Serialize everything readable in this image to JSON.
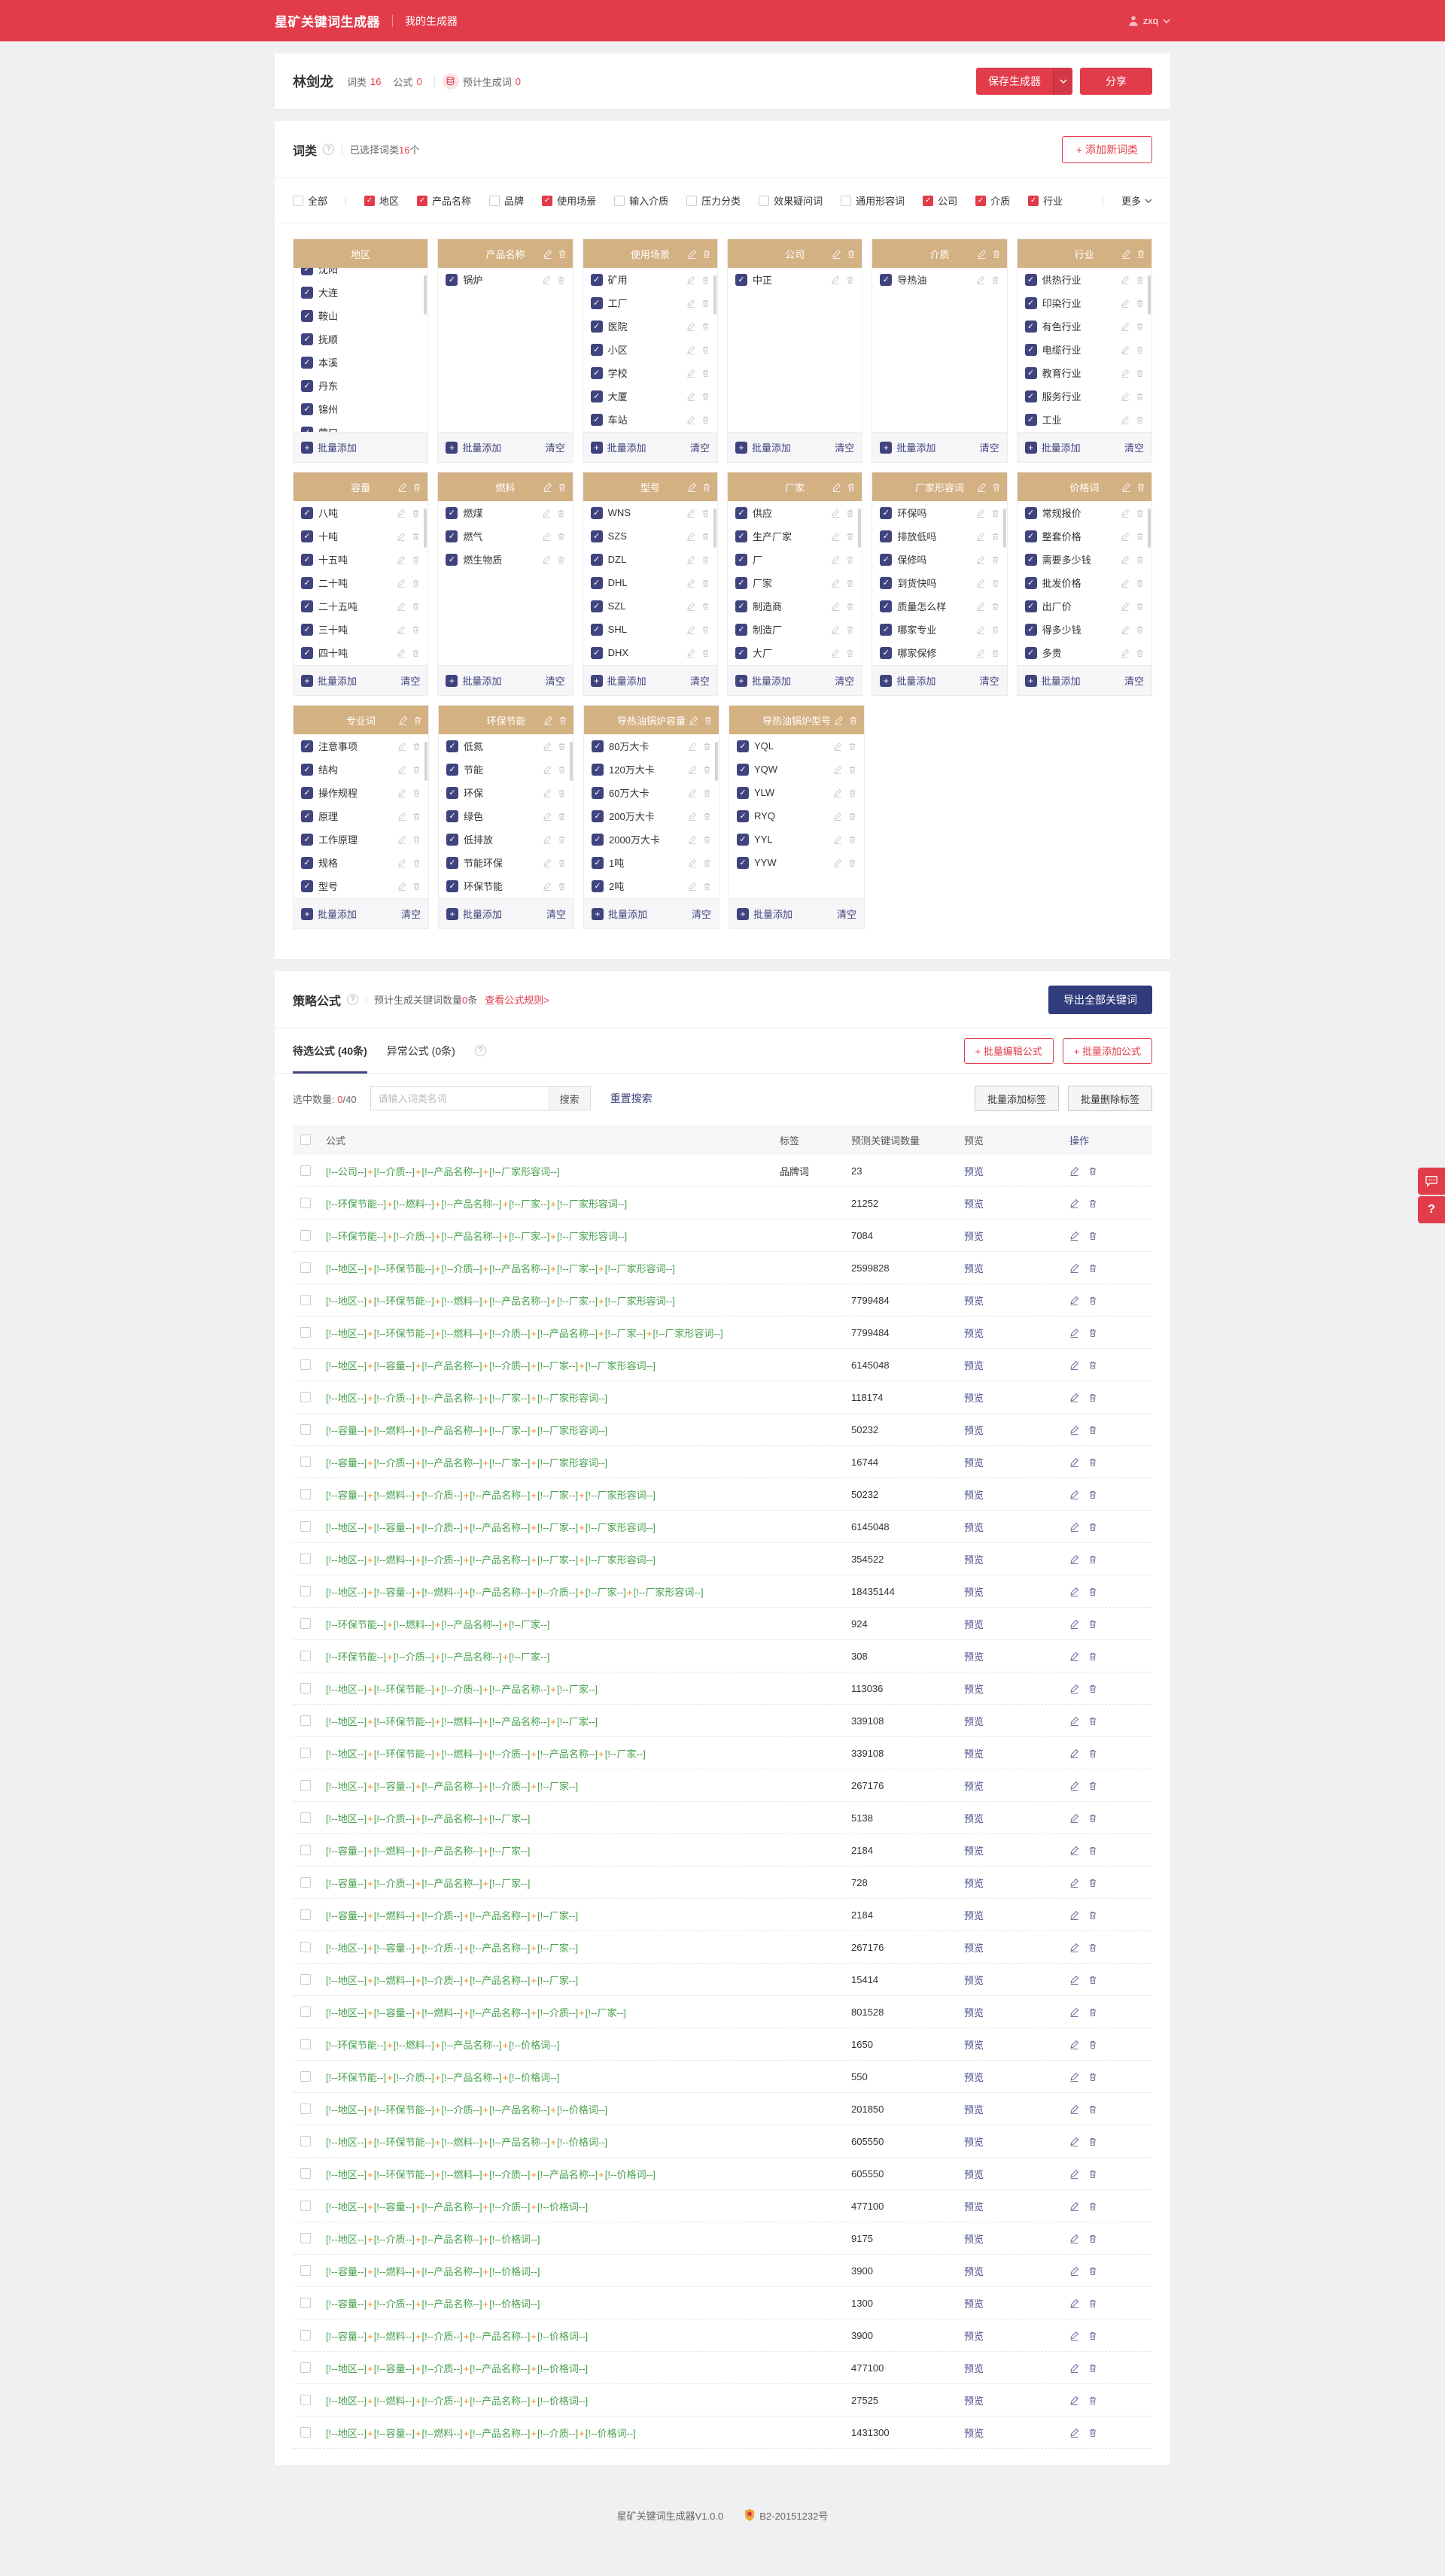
{
  "header": {
    "logo": "星矿关键词生成器",
    "nav_my_generator": "我的生成器",
    "username": "zxq"
  },
  "titlebar": {
    "name": "林剑龙",
    "wordclass_label": "词类",
    "wordclass_count": "16",
    "formula_label": "公式",
    "formula_count": "0",
    "estimate_label": "预计生成词",
    "estimate_count": "0",
    "save_button": "保存生成器",
    "share_button": "分享"
  },
  "wordclass": {
    "title": "词类",
    "selected_prefix": "已选择词类",
    "selected_count": "16",
    "selected_suffix": "个",
    "add_button_label": "+ 添加新词类",
    "more_label": "更多",
    "batch_add_label": "批量添加",
    "clear_label": "清空",
    "filters": [
      {
        "label": "全部",
        "checked": false
      },
      {
        "label": "地区",
        "checked": true
      },
      {
        "label": "产品名称",
        "checked": true
      },
      {
        "label": "品牌",
        "checked": false
      },
      {
        "label": "使用场景",
        "checked": true
      },
      {
        "label": "输入介质",
        "checked": false
      },
      {
        "label": "压力分类",
        "checked": false
      },
      {
        "label": "效果疑问词",
        "checked": false
      },
      {
        "label": "通用形容词",
        "checked": false
      },
      {
        "label": "公司",
        "checked": true
      },
      {
        "label": "介质",
        "checked": true
      },
      {
        "label": "行业",
        "checked": true
      }
    ],
    "card_rows": [
      [
        {
          "title": "地区",
          "editable": false,
          "scrollbar": true,
          "scrolled": true,
          "items": [
            "沈阳",
            "大连",
            "鞍山",
            "抚顺",
            "本溪",
            "丹东",
            "锦州",
            "营口"
          ]
        },
        {
          "title": "产品名称",
          "scrollbar": false,
          "items": [
            "锅炉"
          ]
        },
        {
          "title": "使用场景",
          "scrollbar": true,
          "items": [
            "矿用",
            "工厂",
            "医院",
            "小区",
            "学校",
            "大厦",
            "车站"
          ]
        },
        {
          "title": "公司",
          "scrollbar": false,
          "items": [
            "中正"
          ]
        },
        {
          "title": "介质",
          "scrollbar": false,
          "items": [
            "导热油"
          ]
        },
        {
          "title": "行业",
          "scrollbar": true,
          "items": [
            "供热行业",
            "印染行业",
            "有色行业",
            "电缆行业",
            "教育行业",
            "服务行业",
            "工业"
          ]
        }
      ],
      [
        {
          "title": "容量",
          "scrollbar": true,
          "items": [
            "八吨",
            "十吨",
            "十五吨",
            "二十吨",
            "二十五吨",
            "三十吨",
            "四十吨"
          ]
        },
        {
          "title": "燃料",
          "scrollbar": false,
          "items": [
            "燃煤",
            "燃气",
            "燃生物质"
          ]
        },
        {
          "title": "型号",
          "scrollbar": true,
          "items": [
            "WNS",
            "SZS",
            "DZL",
            "DHL",
            "SZL",
            "SHL",
            "DHX"
          ]
        },
        {
          "title": "厂家",
          "scrollbar": true,
          "items": [
            "供应",
            "生产厂家",
            "厂",
            "厂家",
            "制造商",
            "制造厂",
            "大厂"
          ]
        },
        {
          "title": "厂家形容词",
          "scrollbar": true,
          "items": [
            "环保吗",
            "排放低吗",
            "保修吗",
            "到货快吗",
            "质量怎么样",
            "哪家专业",
            "哪家保修"
          ]
        },
        {
          "title": "价格词",
          "scrollbar": true,
          "items": [
            "常规报价",
            "整套价格",
            "需要多少钱",
            "批发价格",
            "出厂价",
            "得多少钱",
            "多贵"
          ]
        }
      ],
      [
        {
          "title": "专业词",
          "scrollbar": true,
          "items": [
            "注意事项",
            "结构",
            "操作规程",
            "原理",
            "工作原理",
            "规格",
            "型号"
          ]
        },
        {
          "title": "环保节能",
          "scrollbar": true,
          "items": [
            "低氮",
            "节能",
            "环保",
            "绿色",
            "低排放",
            "节能环保",
            "环保节能"
          ]
        },
        {
          "title": "导热油锅炉容量",
          "scrollbar": true,
          "items": [
            "80万大卡",
            "120万大卡",
            "60万大卡",
            "200万大卡",
            "2000万大卡",
            "1吨",
            "2吨"
          ]
        },
        {
          "title": "导热油锅炉型号",
          "scrollbar": false,
          "items": [
            "YQL",
            "YQW",
            "YLW",
            "RYQ",
            "YYL",
            "YYW"
          ]
        }
      ]
    ]
  },
  "strategy": {
    "title": "策略公式",
    "estimate_prefix": "预计生成关键词数量",
    "estimate_count": "0",
    "estimate_suffix": "条",
    "rules_link": "查看公式规则>",
    "export_button": "导出全部关键词",
    "tab_pending": "待选公式 (40条)",
    "tab_abnormal": "异常公式 (0条)",
    "batch_edit_button": "+ 批量编辑公式",
    "batch_add_button": "+ 批量添加公式",
    "selected_label": "选中数量:",
    "selected_value": "0",
    "selected_total": "/40",
    "search_placeholder": "请输入词类名词",
    "search_button": "搜索",
    "reset_search": "重置搜索",
    "batch_add_tag_button": "批量添加标签",
    "batch_delete_tag_button": "批量删除标签",
    "table": {
      "headers": {
        "formula": "公式",
        "tag": "标签",
        "count": "预测关键词数量",
        "preview": "预览",
        "action": "操作"
      },
      "preview_label": "预览",
      "rows": [
        {
          "formula": "[!--公司--]+[!--介质--]+[!--产品名称--]+[!--厂家形容词--]",
          "tag": "品牌词",
          "count": "23"
        },
        {
          "formula": "[!--环保节能--]+[!--燃料--]+[!--产品名称--]+[!--厂家--]+[!--厂家形容词--]",
          "tag": "",
          "count": "21252"
        },
        {
          "formula": "[!--环保节能--]+[!--介质--]+[!--产品名称--]+[!--厂家--]+[!--厂家形容词--]",
          "tag": "",
          "count": "7084"
        },
        {
          "formula": "[!--地区--]+[!--环保节能--]+[!--介质--]+[!--产品名称--]+[!--厂家--]+[!--厂家形容词--]",
          "tag": "",
          "count": "2599828"
        },
        {
          "formula": "[!--地区--]+[!--环保节能--]+[!--燃料--]+[!--产品名称--]+[!--厂家--]+[!--厂家形容词--]",
          "tag": "",
          "count": "7799484"
        },
        {
          "formula": "[!--地区--]+[!--环保节能--]+[!--燃料--]+[!--介质--]+[!--产品名称--]+[!--厂家--]+[!--厂家形容词--]",
          "tag": "",
          "count": "7799484"
        },
        {
          "formula": "[!--地区--]+[!--容量--]+[!--产品名称--]+[!--介质--]+[!--厂家--]+[!--厂家形容词--]",
          "tag": "",
          "count": "6145048"
        },
        {
          "formula": "[!--地区--]+[!--介质--]+[!--产品名称--]+[!--厂家--]+[!--厂家形容词--]",
          "tag": "",
          "count": "118174"
        },
        {
          "formula": "[!--容量--]+[!--燃料--]+[!--产品名称--]+[!--厂家--]+[!--厂家形容词--]",
          "tag": "",
          "count": "50232"
        },
        {
          "formula": "[!--容量--]+[!--介质--]+[!--产品名称--]+[!--厂家--]+[!--厂家形容词--]",
          "tag": "",
          "count": "16744"
        },
        {
          "formula": "[!--容量--]+[!--燃料--]+[!--介质--]+[!--产品名称--]+[!--厂家--]+[!--厂家形容词--]",
          "tag": "",
          "count": "50232"
        },
        {
          "formula": "[!--地区--]+[!--容量--]+[!--介质--]+[!--产品名称--]+[!--厂家--]+[!--厂家形容词--]",
          "tag": "",
          "count": "6145048"
        },
        {
          "formula": "[!--地区--]+[!--燃料--]+[!--介质--]+[!--产品名称--]+[!--厂家--]+[!--厂家形容词--]",
          "tag": "",
          "count": "354522"
        },
        {
          "formula": "[!--地区--]+[!--容量--]+[!--燃料--]+[!--产品名称--]+[!--介质--]+[!--厂家--]+[!--厂家形容词--]",
          "tag": "",
          "count": "18435144"
        },
        {
          "formula": "[!--环保节能--]+[!--燃料--]+[!--产品名称--]+[!--厂家--]",
          "tag": "",
          "count": "924"
        },
        {
          "formula": "[!--环保节能--]+[!--介质--]+[!--产品名称--]+[!--厂家--]",
          "tag": "",
          "count": "308"
        },
        {
          "formula": "[!--地区--]+[!--环保节能--]+[!--介质--]+[!--产品名称--]+[!--厂家--]",
          "tag": "",
          "count": "113036"
        },
        {
          "formula": "[!--地区--]+[!--环保节能--]+[!--燃料--]+[!--产品名称--]+[!--厂家--]",
          "tag": "",
          "count": "339108"
        },
        {
          "formula": "[!--地区--]+[!--环保节能--]+[!--燃料--]+[!--介质--]+[!--产品名称--]+[!--厂家--]",
          "tag": "",
          "count": "339108"
        },
        {
          "formula": "[!--地区--]+[!--容量--]+[!--产品名称--]+[!--介质--]+[!--厂家--]",
          "tag": "",
          "count": "267176"
        },
        {
          "formula": "[!--地区--]+[!--介质--]+[!--产品名称--]+[!--厂家--]",
          "tag": "",
          "count": "5138"
        },
        {
          "formula": "[!--容量--]+[!--燃料--]+[!--产品名称--]+[!--厂家--]",
          "tag": "",
          "count": "2184"
        },
        {
          "formula": "[!--容量--]+[!--介质--]+[!--产品名称--]+[!--厂家--]",
          "tag": "",
          "count": "728"
        },
        {
          "formula": "[!--容量--]+[!--燃料--]+[!--介质--]+[!--产品名称--]+[!--厂家--]",
          "tag": "",
          "count": "2184"
        },
        {
          "formula": "[!--地区--]+[!--容量--]+[!--介质--]+[!--产品名称--]+[!--厂家--]",
          "tag": "",
          "count": "267176"
        },
        {
          "formula": "[!--地区--]+[!--燃料--]+[!--介质--]+[!--产品名称--]+[!--厂家--]",
          "tag": "",
          "count": "15414"
        },
        {
          "formula": "[!--地区--]+[!--容量--]+[!--燃料--]+[!--产品名称--]+[!--介质--]+[!--厂家--]",
          "tag": "",
          "count": "801528"
        },
        {
          "formula": "[!--环保节能--]+[!--燃料--]+[!--产品名称--]+[!--价格词--]",
          "tag": "",
          "count": "1650"
        },
        {
          "formula": "[!--环保节能--]+[!--介质--]+[!--产品名称--]+[!--价格词--]",
          "tag": "",
          "count": "550"
        },
        {
          "formula": "[!--地区--]+[!--环保节能--]+[!--介质--]+[!--产品名称--]+[!--价格词--]",
          "tag": "",
          "count": "201850"
        },
        {
          "formula": "[!--地区--]+[!--环保节能--]+[!--燃料--]+[!--产品名称--]+[!--价格词--]",
          "tag": "",
          "count": "605550"
        },
        {
          "formula": "[!--地区--]+[!--环保节能--]+[!--燃料--]+[!--介质--]+[!--产品名称--]+[!--价格词--]",
          "tag": "",
          "count": "605550"
        },
        {
          "formula": "[!--地区--]+[!--容量--]+[!--产品名称--]+[!--介质--]+[!--价格词--]",
          "tag": "",
          "count": "477100"
        },
        {
          "formula": "[!--地区--]+[!--介质--]+[!--产品名称--]+[!--价格词--]",
          "tag": "",
          "count": "9175"
        },
        {
          "formula": "[!--容量--]+[!--燃料--]+[!--产品名称--]+[!--价格词--]",
          "tag": "",
          "count": "3900"
        },
        {
          "formula": "[!--容量--]+[!--介质--]+[!--产品名称--]+[!--价格词--]",
          "tag": "",
          "count": "1300"
        },
        {
          "formula": "[!--容量--]+[!--燃料--]+[!--介质--]+[!--产品名称--]+[!--价格词--]",
          "tag": "",
          "count": "3900"
        },
        {
          "formula": "[!--地区--]+[!--容量--]+[!--介质--]+[!--产品名称--]+[!--价格词--]",
          "tag": "",
          "count": "477100"
        },
        {
          "formula": "[!--地区--]+[!--燃料--]+[!--介质--]+[!--产品名称--]+[!--价格词--]",
          "tag": "",
          "count": "27525"
        },
        {
          "formula": "[!--地区--]+[!--容量--]+[!--燃料--]+[!--产品名称--]+[!--介质--]+[!--价格词--]",
          "tag": "",
          "count": "1431300"
        }
      ]
    }
  },
  "footer": {
    "version": "星矿关键词生成器V1.0.0",
    "icp": "B2-20151232号"
  },
  "colors": {
    "primary_red": "#e23c4b",
    "indigo": "#40447e",
    "card_header_tan": "#d4b183",
    "formula_green": "#46a04c",
    "plus_orange": "#f08519",
    "export_navy": "#303c7c"
  }
}
